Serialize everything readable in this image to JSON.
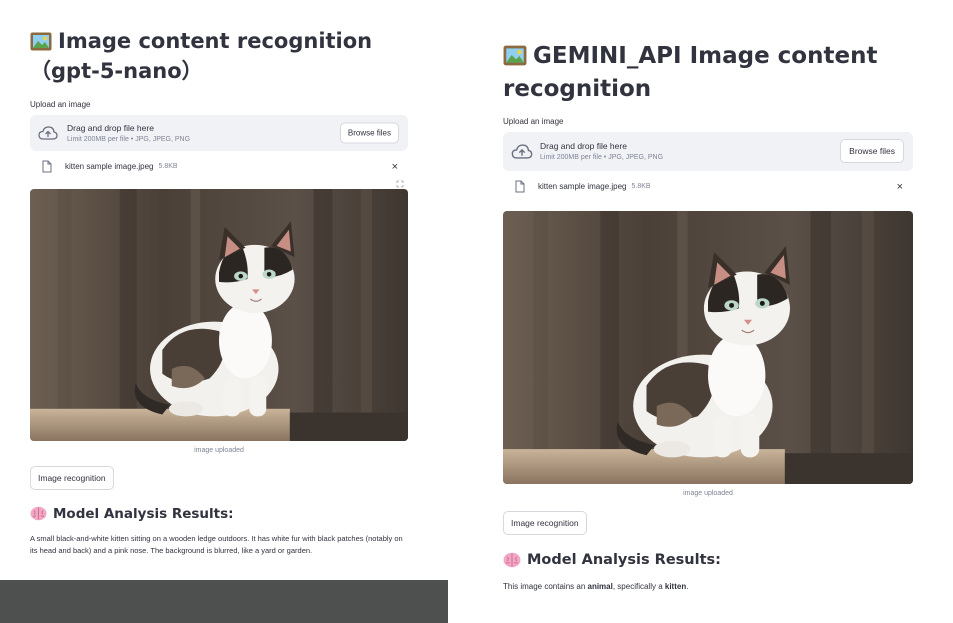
{
  "left": {
    "title": "Image content recognition（gpt-5-nano）",
    "upload_label": "Upload an image",
    "dropzone": {
      "main": "Drag and drop file here",
      "sub": "Limit 200MB per file • JPG, JPEG, PNG",
      "browse": "Browse files"
    },
    "file": {
      "name": "kitten sample image.jpeg",
      "size": "5.8KB",
      "close": "×"
    },
    "caption": "image uploaded",
    "button": "Image recognition",
    "results_heading": "Model Analysis Results:",
    "result_text": "A small black-and-white kitten sitting on a wooden ledge outdoors. It has white fur with black patches (notably on its head and back) and a pink nose. The background is blurred, like a yard or garden."
  },
  "right": {
    "title": "GEMINI_API Image content recognition",
    "upload_label": "Upload an image",
    "dropzone": {
      "main": "Drag and drop file here",
      "sub": "Limit 200MB per file • JPG, JPEG, PNG",
      "browse": "Browse files"
    },
    "file": {
      "name": "kitten sample image.jpeg",
      "size": "5.8KB",
      "close": "×"
    },
    "caption": "image uploaded",
    "button": "Image recognition",
    "results_heading": "Model Analysis Results:",
    "result_text": {
      "prefix": "This image contains an ",
      "word1": "animal",
      "middle": ", specifically a ",
      "word2": "kitten",
      "suffix": "."
    }
  },
  "icons": {
    "title": "framed-picture-icon",
    "upload": "cloud-upload-icon",
    "file": "file-icon",
    "results": "brain-icon",
    "fullscreen": "fullscreen-icon"
  },
  "colors": {
    "dropzone_bg": "#f0f2f6",
    "text": "#31333f",
    "muted": "#808495",
    "bottom_bar": "#4e5050"
  }
}
